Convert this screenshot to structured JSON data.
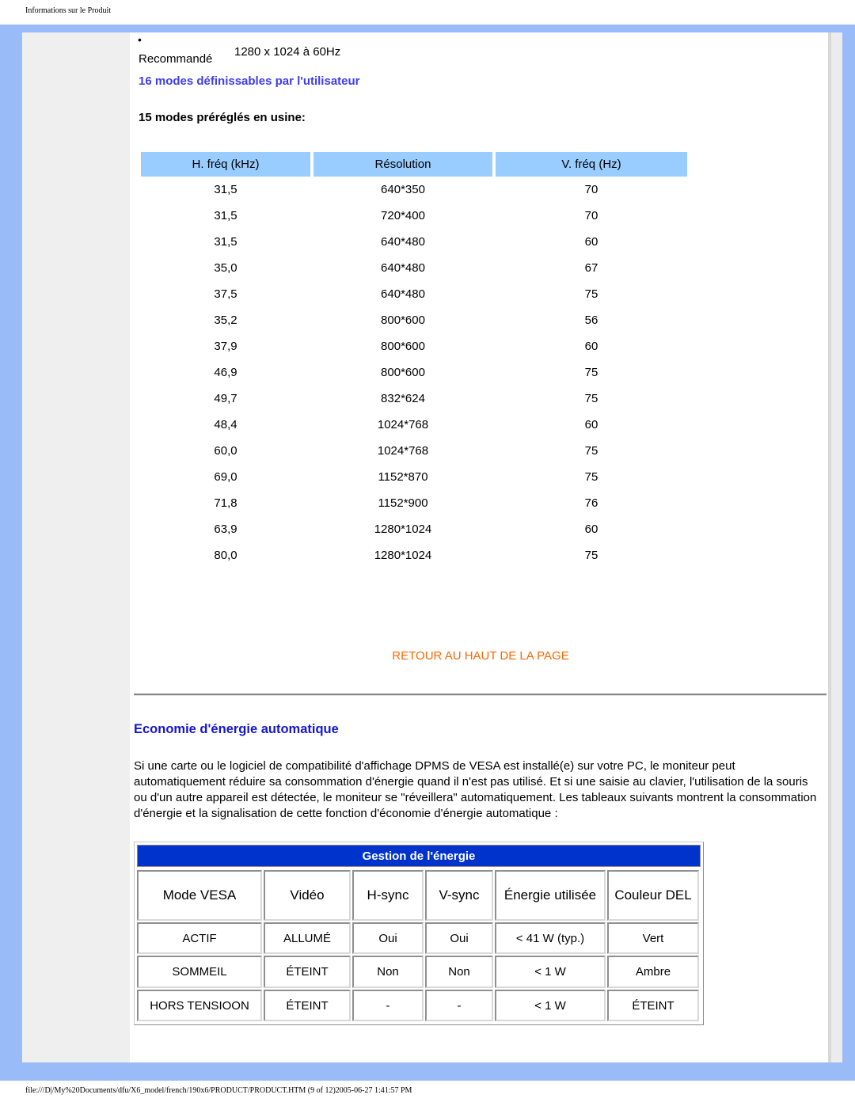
{
  "header": {
    "title": "Informations sur le Produit"
  },
  "recommended": {
    "bullet": "•",
    "label": "Recommandé",
    "value": "1280 x 1024 à 60Hz"
  },
  "user_modes": "16 modes définissables par l'utilisateur",
  "preset_modes_title": "15 modes préréglés en usine:",
  "timing_table": {
    "headers": [
      "H. fréq (kHz)",
      "Résolution",
      "V. fréq (Hz)"
    ],
    "rows": [
      [
        "31,5",
        "640*350",
        "70"
      ],
      [
        "31,5",
        "720*400",
        "70"
      ],
      [
        "31,5",
        "640*480",
        "60"
      ],
      [
        "35,0",
        "640*480",
        "67"
      ],
      [
        "37,5",
        "640*480",
        "75"
      ],
      [
        "35,2",
        "800*600",
        "56"
      ],
      [
        "37,9",
        "800*600",
        "60"
      ],
      [
        "46,9",
        "800*600",
        "75"
      ],
      [
        "49,7",
        "832*624",
        "75"
      ],
      [
        "48,4",
        "1024*768",
        "60"
      ],
      [
        "60,0",
        "1024*768",
        "75"
      ],
      [
        "69,0",
        "1152*870",
        "75"
      ],
      [
        "71,8",
        "1152*900",
        "76"
      ],
      [
        "63,9",
        "1280*1024",
        "60"
      ],
      [
        "80,0",
        "1280*1024",
        "75"
      ]
    ]
  },
  "back_to_top": "RETOUR AU HAUT DE LA PAGE",
  "power_section": {
    "title": "Economie d'énergie automatique",
    "paragraph": "Si une carte ou le logiciel de compatibilité d'affichage DPMS de VESA est installé(e) sur votre PC, le moniteur peut automatiquement réduire sa consommation d'énergie quand il n'est pas utilisé. Et si une saisie au clavier, l'utilisation de la souris ou d'un autre appareil est détectée, le moniteur se \"réveillera\" automatiquement. Les tableaux suivants montrent la consommation d'énergie et la signalisation de cette fonction d'économie d'énergie automatique :",
    "table": {
      "title": "Gestion de l'énergie",
      "headers": [
        "Mode VESA",
        "Vidéo",
        "H-sync",
        "V-sync",
        "Énergie utilisée",
        "Couleur DEL"
      ],
      "rows": [
        [
          "ACTIF",
          "ALLUMÉ",
          "Oui",
          "Oui",
          "< 41 W (typ.)",
          "Vert"
        ],
        [
          "SOMMEIL",
          "ÉTEINT",
          "Non",
          "Non",
          "< 1 W",
          "Ambre"
        ],
        [
          "HORS TENSIOON",
          "ÉTEINT",
          "-",
          "-",
          "< 1 W",
          "ÉTEINT"
        ]
      ]
    }
  },
  "colors": {
    "frame": "#99bbf7",
    "link_blue": "#3d3df5",
    "section_blue": "#1515d0",
    "table_header": "#99ccff",
    "power_title_bg": "#0033cc",
    "back_to_top": "#ff6600"
  },
  "footer": {
    "text": "file:///D|/My%20Documents/dfu/X6_model/french/190x6/PRODUCT/PRODUCT.HTM (9 of 12)2005-06-27 1:41:57 PM"
  }
}
